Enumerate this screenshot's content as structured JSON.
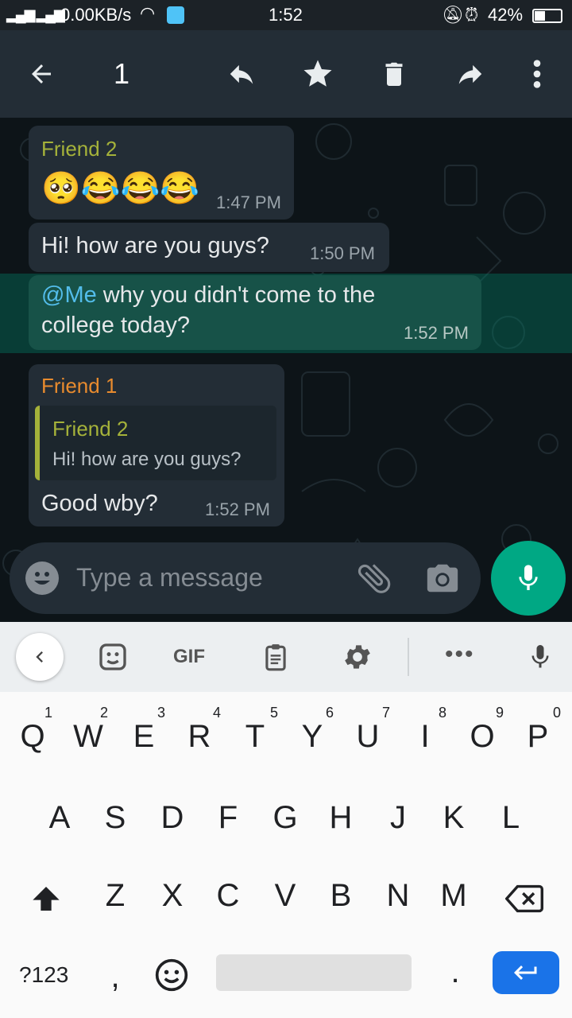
{
  "status_bar": {
    "speed": "0.00KB/s",
    "time": "1:52",
    "battery": "42%"
  },
  "toolbar": {
    "selected_count": "1"
  },
  "messages": [
    {
      "sender": "Friend 2",
      "sender_color": "#a5b23a",
      "text": "🥺😂😂😂",
      "time": "1:47 PM"
    },
    {
      "text": "Hi! how are you guys?",
      "time": "1:50 PM"
    },
    {
      "mention": "@Me",
      "text_line1": " why you didn't come to the",
      "text_line2": "college today?",
      "time": "1:52 PM"
    },
    {
      "sender": "Friend 1",
      "sender_color": "#e88b2e",
      "quote": {
        "sender": "Friend 2",
        "text": "Hi! how are you guys?"
      },
      "text": "Good wby?",
      "time": "1:52 PM"
    }
  ],
  "input": {
    "placeholder": "Type a message"
  },
  "keyboard": {
    "toolbar": {
      "gif": "GIF"
    },
    "row1": [
      "Q",
      "W",
      "E",
      "R",
      "T",
      "Y",
      "U",
      "I",
      "O",
      "P"
    ],
    "row1_hints": [
      "1",
      "2",
      "3",
      "4",
      "5",
      "6",
      "7",
      "8",
      "9",
      "0"
    ],
    "row2": [
      "A",
      "S",
      "D",
      "F",
      "G",
      "H",
      "J",
      "K",
      "L"
    ],
    "row3": [
      "Z",
      "X",
      "C",
      "V",
      "B",
      "N",
      "M"
    ],
    "symbols": "?123",
    "comma": ",",
    "period": "."
  },
  "colors": {
    "accent": "#00a884",
    "mention": "#53bdeb",
    "enter": "#1a73e8"
  }
}
